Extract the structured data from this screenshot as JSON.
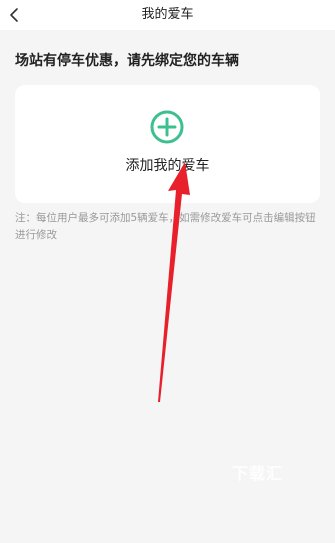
{
  "nav": {
    "back_icon": "chevron-left-icon",
    "title": "我的爱车"
  },
  "main": {
    "heading": "场站有停车优惠，请先绑定您的车辆",
    "add_card": {
      "icon": "plus-circle-icon",
      "label": "添加我的爱车",
      "accent_color": "#3dbf8f"
    },
    "note": "注：每位用户最多可添加5辆爱车，如需修改爱车可点击编辑按钮进行修改"
  },
  "overlay": {
    "arrow_color": "#e8202b",
    "watermark": "下载汇"
  }
}
